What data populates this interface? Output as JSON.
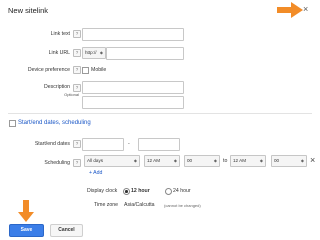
{
  "dialog": {
    "title": "New sitelink",
    "close_glyph": "×"
  },
  "form": {
    "link_text": {
      "label": "Link text",
      "value": ""
    },
    "link_url": {
      "label": "Link URL",
      "protocol": "http://"
    },
    "device_preference": {
      "label": "Device preference",
      "option": "Mobile",
      "checked": false
    },
    "description": {
      "label": "Description",
      "sublabel": "Optional",
      "line1": "",
      "line2": ""
    },
    "start_end_section": {
      "label": "Start/end dates, scheduling",
      "checked": false
    },
    "start_end_dates": {
      "label": "Start/end dates",
      "start": "",
      "separator": "-",
      "end": ""
    },
    "scheduling": {
      "label": "Scheduling",
      "days": "All days",
      "start_hour": "12 AM",
      "start_min": "00",
      "to": "to",
      "end_hour": "12 AM",
      "end_min": "00",
      "remove_glyph": "×",
      "add_label": "+ Add"
    },
    "display_clock": {
      "label": "Display clock",
      "option_12": "12 hour",
      "option_24": "24 hour",
      "selected": "12 hour"
    },
    "time_zone": {
      "label": "Time zone",
      "value": "Asia/Calcutta",
      "note": "(cannot be changed)"
    },
    "help_glyph": "?"
  },
  "buttons": {
    "save": "Save",
    "cancel": "Cancel"
  },
  "colors": {
    "accent_blue": "#3b7ee8",
    "link_blue": "#1a57c7",
    "annotation_arrow": "#f28c28"
  },
  "icons": [
    "close-icon",
    "help-icon",
    "dropdown-arrow-icon",
    "remove-icon",
    "annotation-arrow-icon"
  ]
}
